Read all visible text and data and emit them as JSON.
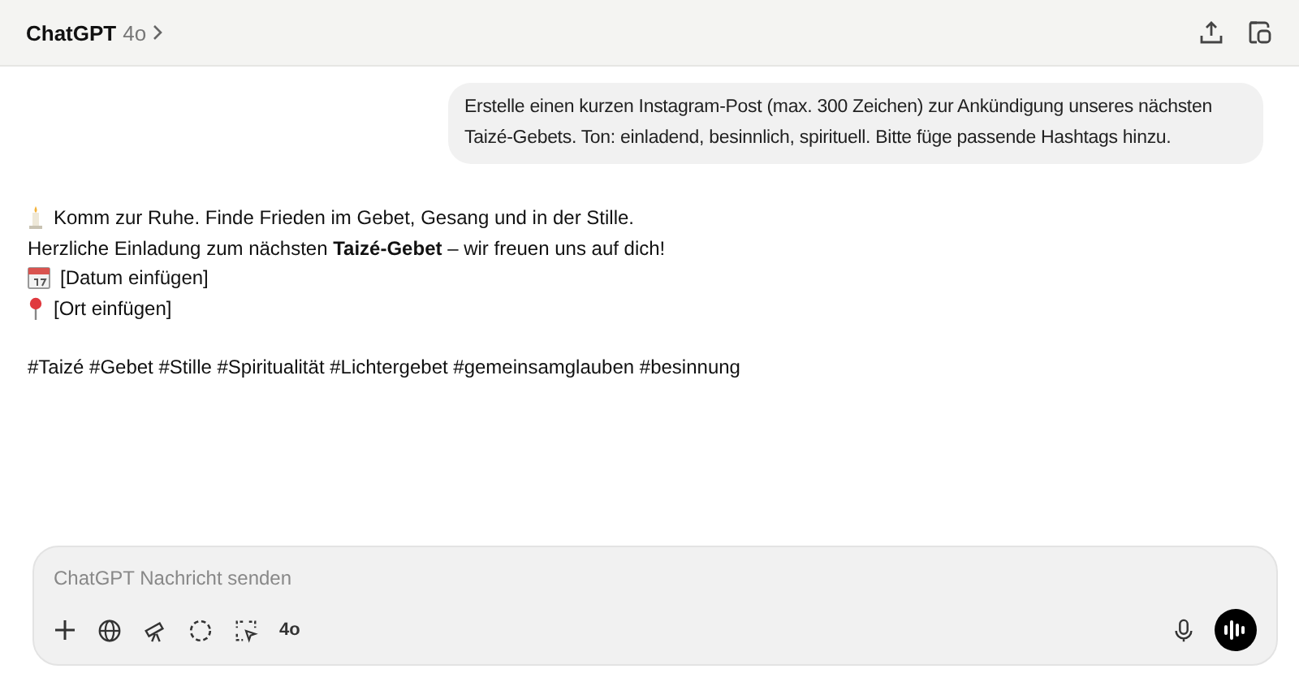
{
  "header": {
    "title": "ChatGPT",
    "model": "4o"
  },
  "user_message": {
    "text": "Erstelle einen kurzen Instagram-Post (max. 300 Zeichen) zur Ankündigung unseres nächsten Taizé-Gebets. Ton: einladend, besinnlich, spirituell. Bitte füge passende Hashtags hinzu."
  },
  "reply_lines": [
    {
      "kind": "candle",
      "text": "Komm zur Ruhe. Finde Frieden im Gebet, Gesang und in der Stille."
    },
    {
      "kind": "plain",
      "text": "Herzliche Einladung zum nächsten **Taizé-Gebet** – wir freuen uns auf dich!"
    },
    {
      "kind": "calendar",
      "text": "[Datum einfügen]"
    },
    {
      "kind": "pin",
      "text": "[Ort einfügen]"
    },
    {
      "kind": "gap",
      "text": "#Taizé #Gebet #Stille #Spiritualität #Lichtergebet #gemeinsamglauben #besinnung"
    }
  ],
  "composer": {
    "placeholder": "ChatGPT Nachricht senden",
    "model_button": "4o"
  }
}
